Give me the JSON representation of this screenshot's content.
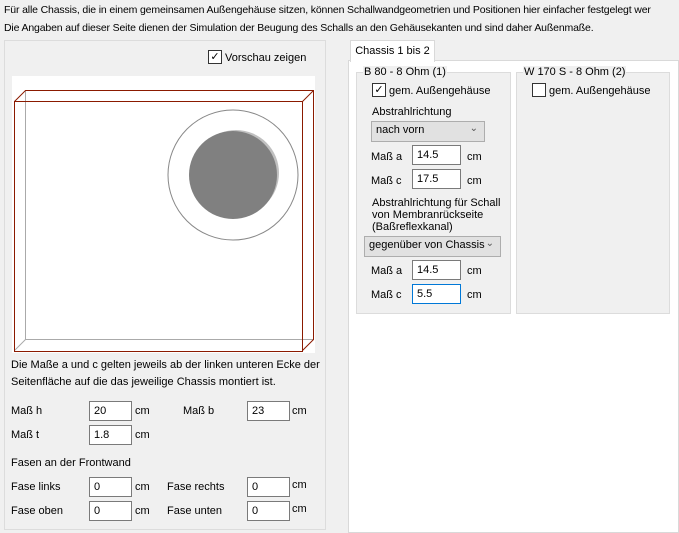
{
  "intro": {
    "line1": "Für alle Chassis, die in einem gemeinsamen Außengehäuse sitzen, können Schallwandgeometrien und Positionen hier einfacher festgelegt wer",
    "line2": "Die Angaben auf dieser Seite dienen der Simulation der  Beugung des Schalls an den Gehäusekanten und sind daher Außenmaße."
  },
  "preview": {
    "checkbox_label": "Vorschau zeigen",
    "checked": true
  },
  "note": {
    "line1": "Die Maße a und c gelten jeweils ab der linken unteren Ecke der",
    "line2": "Seitenfläche auf die das jeweilige Chassis montiert ist."
  },
  "dims": {
    "h_label": "Maß h",
    "h": "20",
    "b_label": "Maß b",
    "b": "23",
    "t_label": "Maß t",
    "t": "1.8",
    "unit": "cm"
  },
  "bevels": {
    "title": "Fasen an der Frontwand",
    "links_label": "Fase links",
    "links": "0",
    "rechts_label": "Fase rechts",
    "rechts": "0",
    "oben_label": "Fase oben",
    "oben": "0",
    "unten_label": "Fase unten",
    "unten": "0"
  },
  "tab": {
    "label": "Chassis 1 bis 2"
  },
  "chassis1": {
    "title": "B 80 - 8 Ohm (1)",
    "common_label": "gem. Außengehäuse",
    "common_checked": true,
    "dir_label": "Abstrahlrichtung",
    "dir_value": "nach vorn",
    "a_label": "Maß a",
    "a": "14.5",
    "c_label": "Maß c",
    "c": "17.5",
    "rear_line1": "Abstrahlrichtung für Schall",
    "rear_line2": "von Membranrückseite",
    "rear_line3": "(Baßreflexkanal)",
    "rear_value": "gegenüber von Chassis",
    "ra_label": "Maß a",
    "ra": "14.5",
    "rc_label": "Maß c",
    "rc": "5.5",
    "unit": "cm"
  },
  "chassis2": {
    "title": "W 170 S - 8 Ohm (2)",
    "common_label": "gem. Außengehäuse",
    "common_checked": false
  },
  "colors": {
    "box_edge": "#8b1a00",
    "driver": "#808080"
  }
}
